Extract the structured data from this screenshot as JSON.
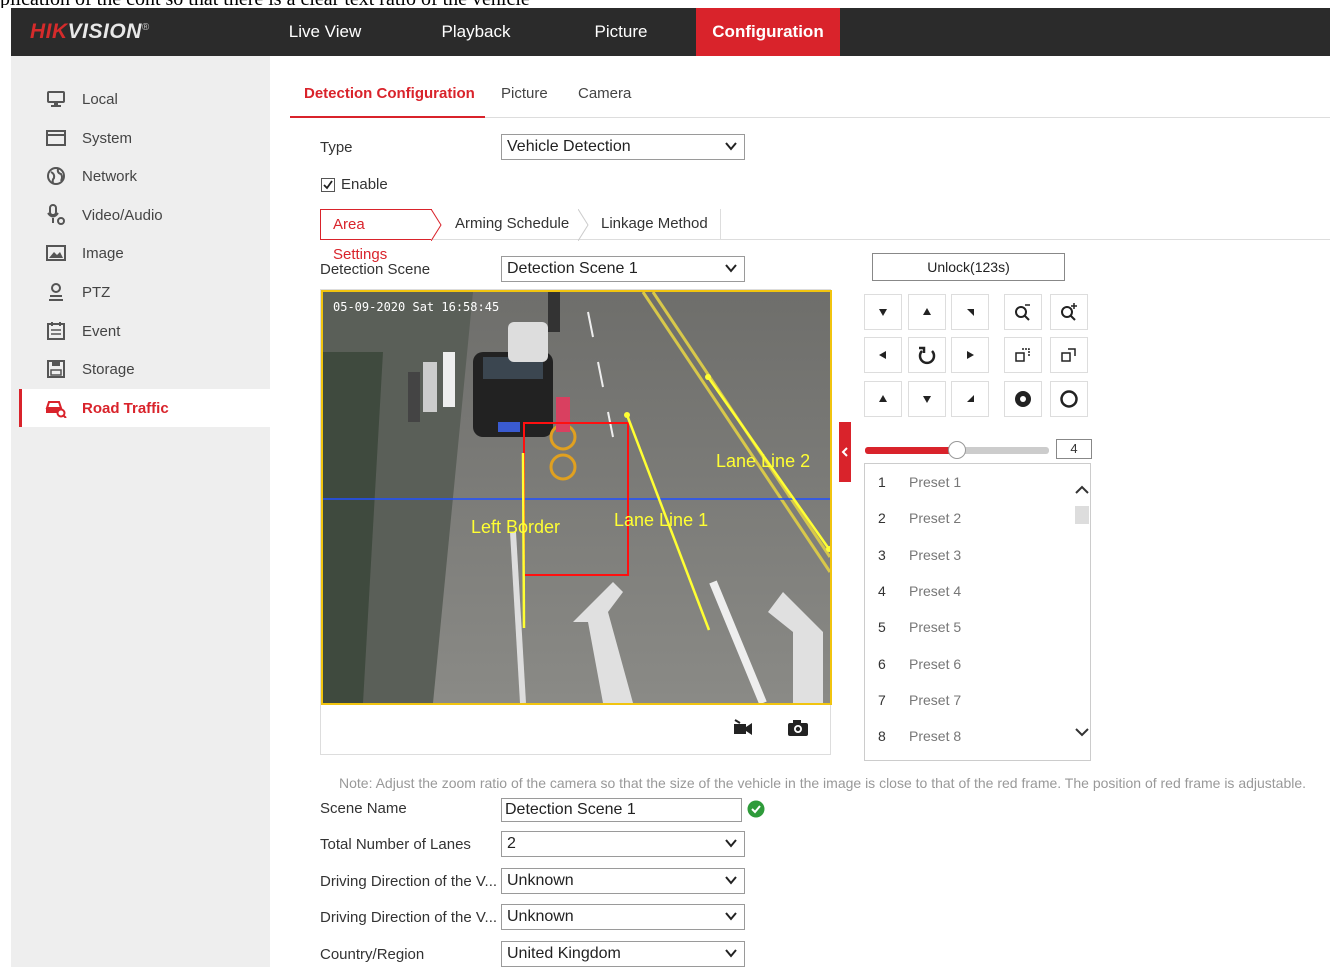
{
  "top_strip": {
    "text": "plication of the cont so that there is a clear text ratio of the vehicle"
  },
  "header": {
    "logo_brand": "HIK",
    "logo_rest": "VISION",
    "logo_mark": "®",
    "nav": [
      {
        "label": "Live View"
      },
      {
        "label": "Playback"
      },
      {
        "label": "Picture"
      },
      {
        "label": "Configuration"
      }
    ]
  },
  "sidebar": {
    "items": [
      {
        "label": "Local",
        "icon": "monitor-icon"
      },
      {
        "label": "System",
        "icon": "system-window-icon"
      },
      {
        "label": "Network",
        "icon": "globe-icon"
      },
      {
        "label": "Video/Audio",
        "icon": "microphone-icon"
      },
      {
        "label": "Image",
        "icon": "image-icon"
      },
      {
        "label": "PTZ",
        "icon": "ptz-person-icon"
      },
      {
        "label": "Event",
        "icon": "calendar-icon"
      },
      {
        "label": "Storage",
        "icon": "save-disk-icon"
      },
      {
        "label": "Road Traffic",
        "icon": "car-search-icon"
      }
    ]
  },
  "tabs": [
    {
      "label": "Detection Configuration"
    },
    {
      "label": "Picture"
    },
    {
      "label": "Camera"
    }
  ],
  "form": {
    "type_label": "Type",
    "type_value": "Vehicle Detection",
    "enable_label": "Enable",
    "enable_checked": true
  },
  "subtabs": [
    {
      "label": "Area Settings"
    },
    {
      "label": "Arming Schedule"
    },
    {
      "label": "Linkage Method"
    }
  ],
  "scene": {
    "label": "Detection Scene",
    "value": "Detection Scene 1"
  },
  "video": {
    "timestamp": "05-09-2020 Sat 16:58:45",
    "labels": {
      "lane2": "Lane Line 2",
      "lane1": "Lane Line 1",
      "left_border": "Left Border"
    }
  },
  "ptz": {
    "unlock_label": "Unlock(123s)",
    "speed": "4",
    "speed_level": 0.5,
    "presets": [
      {
        "num": "1",
        "name": "Preset 1"
      },
      {
        "num": "2",
        "name": "Preset 2"
      },
      {
        "num": "3",
        "name": "Preset 3"
      },
      {
        "num": "4",
        "name": "Preset 4"
      },
      {
        "num": "5",
        "name": "Preset 5"
      },
      {
        "num": "6",
        "name": "Preset 6"
      },
      {
        "num": "7",
        "name": "Preset 7"
      },
      {
        "num": "8",
        "name": "Preset 8"
      }
    ]
  },
  "note": "Note: Adjust the zoom ratio of the camera so that the size of the vehicle in the image is close to that of the red frame. The position of red frame is adjustable.",
  "fields": {
    "scene_name_label": "Scene Name",
    "scene_name_value": "Detection Scene 1",
    "lanes_label": "Total Number of Lanes",
    "lanes_value": "2",
    "dir1_label": "Driving Direction of the V...",
    "dir1_value": "Unknown",
    "dir2_label": "Driving Direction of the V...",
    "dir2_value": "Unknown",
    "country_label": "Country/Region",
    "country_value": "United Kingdom"
  },
  "colors": {
    "brand_red": "#d9232b",
    "header_bg": "#2b2b2b",
    "sidebar_bg": "#eeeeee",
    "overlay_yellow": "#ffff33"
  }
}
